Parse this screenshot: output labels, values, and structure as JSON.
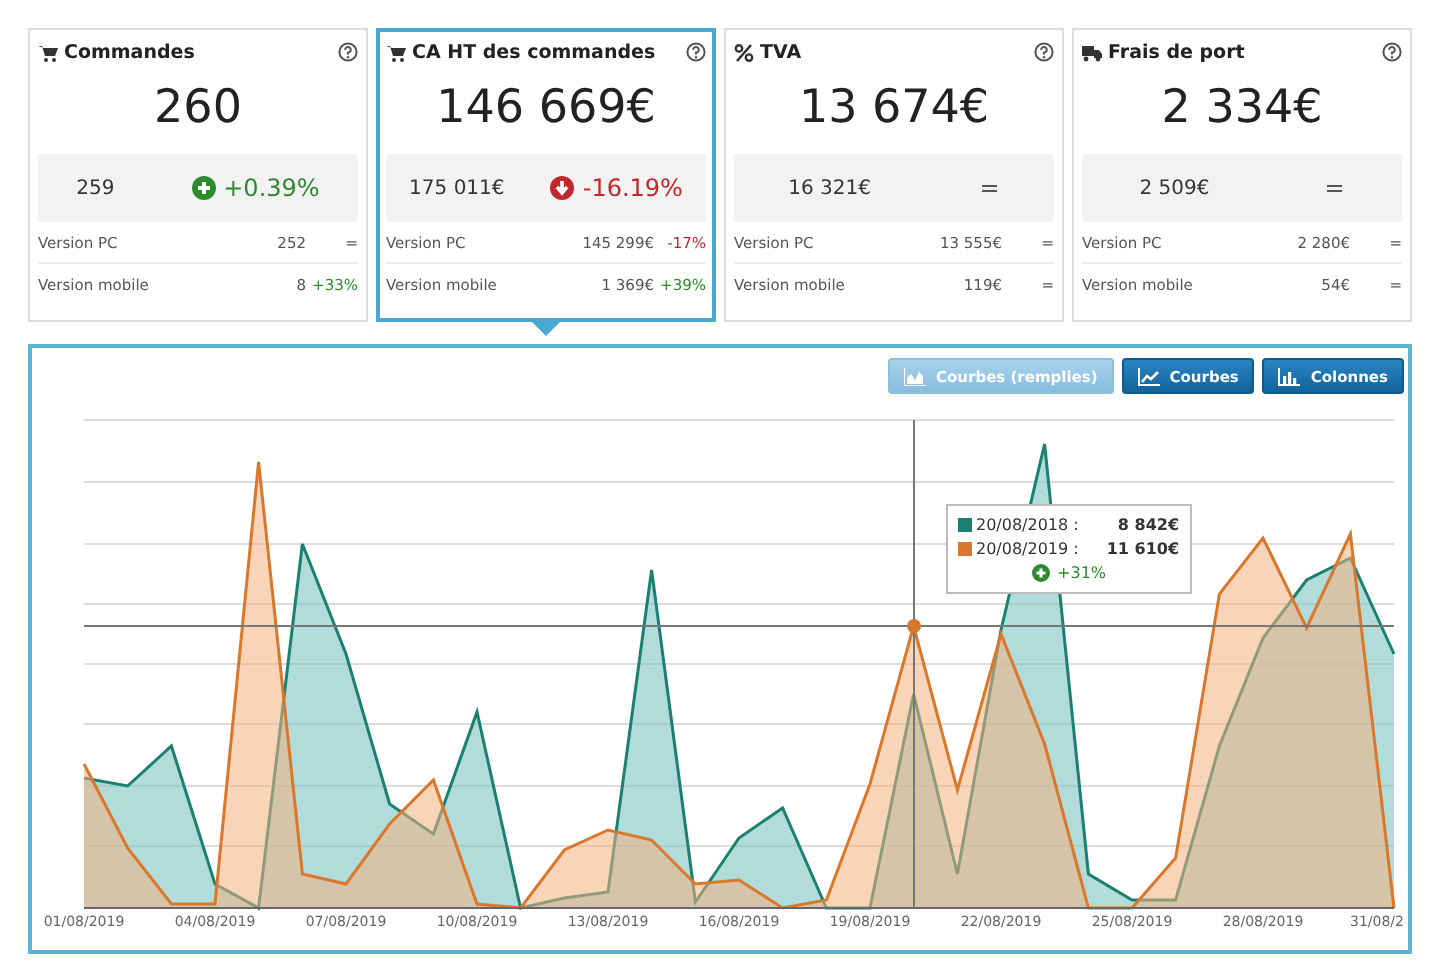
{
  "cards": [
    {
      "kind": "cart",
      "title": "Commandes",
      "selected": false,
      "value": "260",
      "previous": "259",
      "change": {
        "kind": "up",
        "text": "+0.39%"
      },
      "rows": [
        {
          "label": "Version PC",
          "value": "252",
          "change": {
            "kind": "flat",
            "text": "="
          }
        },
        {
          "label": "Version mobile",
          "value": "8",
          "change": {
            "kind": "up",
            "text": "+33%"
          }
        }
      ]
    },
    {
      "kind": "cart",
      "title": "CA HT des commandes",
      "selected": true,
      "value": "146 669€",
      "previous": "175 011€",
      "change": {
        "kind": "down",
        "text": "-16.19%"
      },
      "rows": [
        {
          "label": "Version PC",
          "value": "145 299€",
          "change": {
            "kind": "down",
            "text": "-17%"
          }
        },
        {
          "label": "Version mobile",
          "value": "1 369€",
          "change": {
            "kind": "up",
            "text": "+39%"
          }
        }
      ]
    },
    {
      "kind": "percent",
      "title": "TVA",
      "selected": false,
      "value": "13 674€",
      "previous": "16 321€",
      "change": {
        "kind": "flat",
        "text": "="
      },
      "rows": [
        {
          "label": "Version PC",
          "value": "13 555€",
          "change": {
            "kind": "flat",
            "text": "="
          }
        },
        {
          "label": "Version mobile",
          "value": "119€",
          "change": {
            "kind": "flat",
            "text": "="
          }
        }
      ]
    },
    {
      "kind": "truck",
      "title": "Frais de port",
      "selected": false,
      "value": "2 334€",
      "previous": "2 509€",
      "change": {
        "kind": "flat",
        "text": "="
      },
      "rows": [
        {
          "label": "Version PC",
          "value": "2 280€",
          "change": {
            "kind": "flat",
            "text": "="
          }
        },
        {
          "label": "Version mobile",
          "value": "54€",
          "change": {
            "kind": "flat",
            "text": "="
          }
        }
      ]
    }
  ],
  "chart_buttons": [
    {
      "kind": "area",
      "label": "Courbes (remplies)",
      "selected": true
    },
    {
      "kind": "line",
      "label": "Courbes",
      "selected": false
    },
    {
      "kind": "columns",
      "label": "Colonnes",
      "selected": false
    }
  ],
  "x_labels": [
    "01/08/2019",
    "04/08/2019",
    "07/08/2019",
    "10/08/2019",
    "13/08/2019",
    "16/08/2019",
    "19/08/2019",
    "22/08/2019",
    "25/08/2019",
    "28/08/2019",
    "31/08/2"
  ],
  "tooltip": {
    "entries": [
      {
        "date": "20/08/2018 :",
        "value": "8 842€",
        "color": "#1b8070"
      },
      {
        "date": "20/08/2019 :",
        "value": "11 610€",
        "color": "#d9782c"
      }
    ],
    "change": {
      "kind": "up",
      "text": "+31%"
    }
  }
}
